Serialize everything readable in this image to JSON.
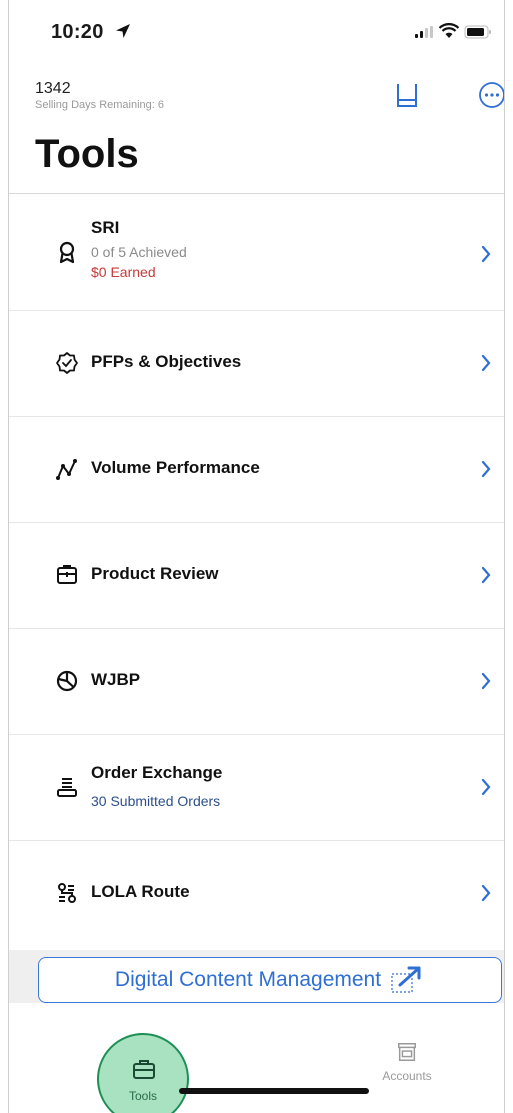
{
  "status_bar": {
    "time": "10:20"
  },
  "header": {
    "account_id": "1342",
    "days_remaining": "Selling Days Remaining: 6",
    "title": "Tools"
  },
  "tools": [
    {
      "title": "SRI",
      "icon": "award-ribbon-icon",
      "subtitle": "0 of 5 Achieved",
      "subtitle2": "$0 Earned"
    },
    {
      "title": "PFPs & Objectives",
      "icon": "badge-check-icon"
    },
    {
      "title": "Volume Performance",
      "icon": "trend-line-icon"
    },
    {
      "title": "Product Review",
      "icon": "package-icon"
    },
    {
      "title": "WJBP",
      "icon": "pie-chart-icon"
    },
    {
      "title": "Order Exchange",
      "icon": "stacked-list-icon",
      "subtitle": "30 Submitted Orders"
    },
    {
      "title": "LOLA Route",
      "icon": "route-icon"
    }
  ],
  "digital_content_button": "Digital Content Management",
  "tab_bar": {
    "tools_label": "Tools",
    "accounts_label": "Accounts",
    "active_tab": "Tools"
  },
  "colors": {
    "accent_blue": "#2f6fd3",
    "earned_red": "#c43a3a",
    "orders_blue": "#2c4f8c",
    "active_tab_fill": "#a8e2c0",
    "active_tab_border": "#1d8f55"
  }
}
